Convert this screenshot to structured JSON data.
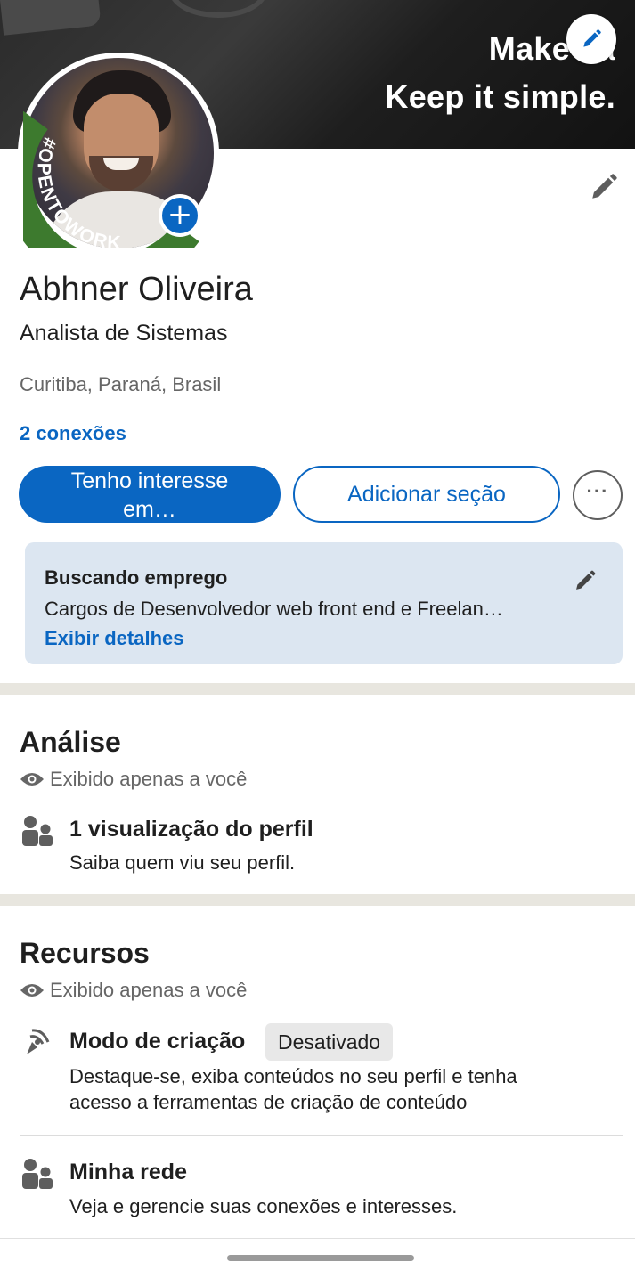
{
  "banner": {
    "line1": "Make ea",
    "line2": "Keep it simple."
  },
  "avatar": {
    "frame_text": "#OPENTOWORK",
    "add_label": "+"
  },
  "profile": {
    "name": "Abhner Oliveira",
    "headline": "Analista de Sistemas",
    "location": "Curitiba, Paraná, Brasil",
    "connections": "2 conexões"
  },
  "actions": {
    "primary_line1": "Tenho interesse",
    "primary_line2": "em…",
    "secondary": "Adicionar seção",
    "more": "···"
  },
  "open_to_work": {
    "title": "Buscando emprego",
    "description": "Cargos de Desenvolvedor web front end e Freelan…",
    "link": "Exibir detalhes"
  },
  "analytics": {
    "title": "Análise",
    "visibility": "Exibido apenas a você",
    "views_title": "1 visualização do perfil",
    "views_desc": "Saiba quem viu seu perfil."
  },
  "resources": {
    "title": "Recursos",
    "visibility": "Exibido apenas a você",
    "creator_title": "Modo de criação",
    "creator_badge": "Desativado",
    "creator_desc_line1": "Destaque-se, exiba conteúdos no seu perfil e tenha",
    "creator_desc_line2": "acesso a ferramentas de criação de conteúdo",
    "network_title": "Minha rede",
    "network_desc": "Veja e gerencie suas conexões e interesses."
  },
  "colors": {
    "brand": "#0a66c2",
    "otw_green": "#3d7a2e",
    "card_bg": "#dce6f1"
  },
  "icons": [
    "pencil-icon",
    "plus-icon",
    "more-icon",
    "eye-icon",
    "people-icon",
    "broadcast-icon"
  ]
}
